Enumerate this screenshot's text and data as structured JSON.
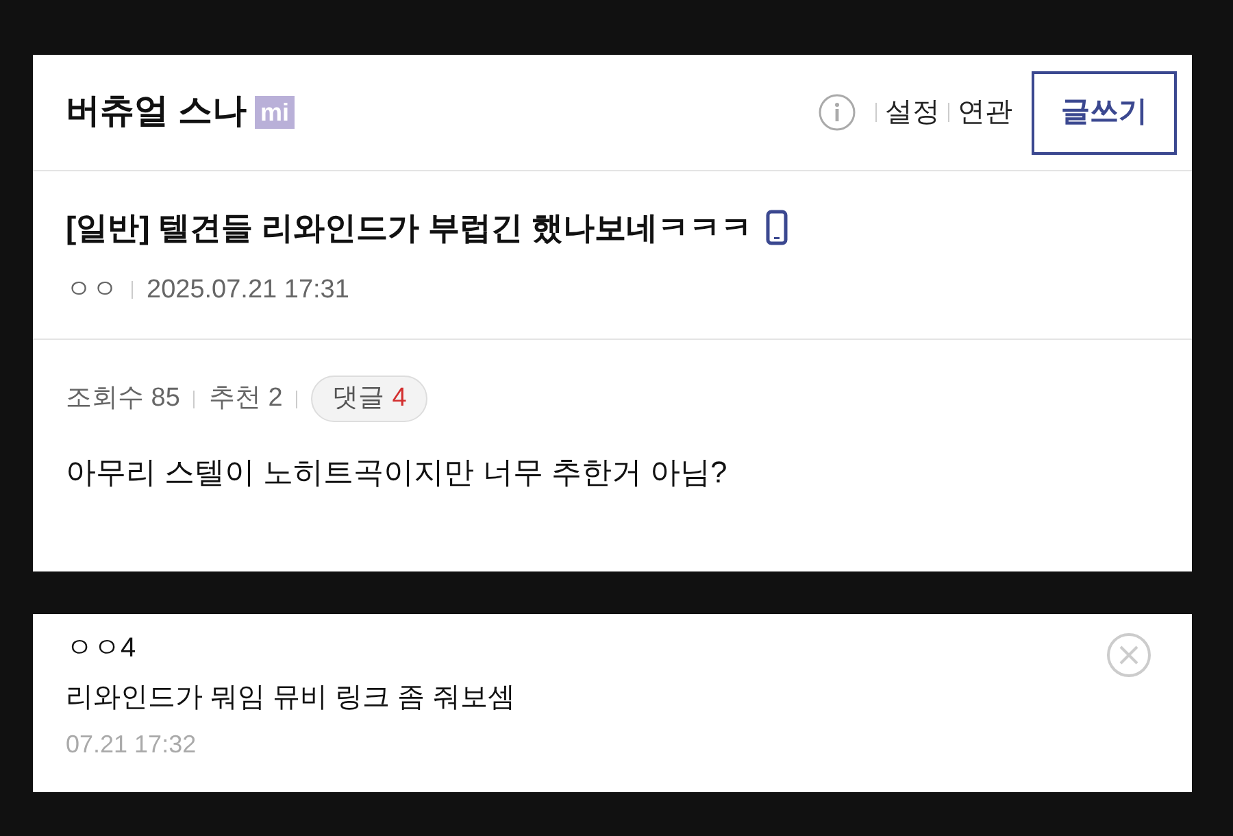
{
  "header": {
    "gallery_name": "버츄얼 스나",
    "badge": "mi",
    "links": [
      "설정",
      "연관"
    ],
    "write_button": "글쓰기"
  },
  "post": {
    "title": "[일반] 텔견들 리와인드가 부럽긴 했나보네ㅋㅋㅋ",
    "mobile": true,
    "author": "ㅇㅇ",
    "date": "2025.07.21 17:31",
    "views_label": "조회수 85",
    "recommend_label": "추천 2",
    "comments_label": "댓글",
    "comments_count": "4",
    "body": "아무리 스텔이 노히트곡이지만 너무 추한거 아님?"
  },
  "comments": [
    {
      "author": "ㅇㅇ4",
      "text": "리와인드가 뭐임 뮤비 링크 좀 줘보셈",
      "time": "07.21 17:32"
    }
  ]
}
